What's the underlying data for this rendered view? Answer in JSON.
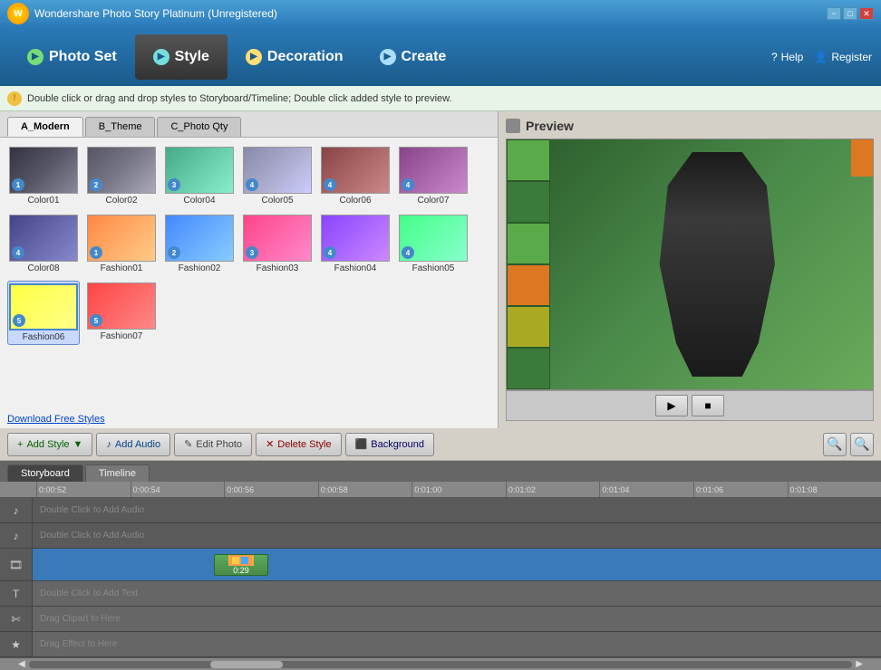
{
  "app": {
    "title": "Wondershare Photo Story Platinum  (Unregistered)"
  },
  "titlebar": {
    "minimize": "−",
    "maximize": "□",
    "close": "✕"
  },
  "navbar": {
    "items": [
      {
        "id": "photo-set",
        "label": "Photo Set",
        "icon": "▶"
      },
      {
        "id": "style",
        "label": "Style",
        "icon": "▶"
      },
      {
        "id": "decoration",
        "label": "Decoration",
        "icon": "▶"
      },
      {
        "id": "create",
        "label": "Create",
        "icon": "▶"
      }
    ],
    "help_label": "Help",
    "register_label": "Register"
  },
  "infobar": {
    "message": "Double click or drag and drop styles to Storyboard/Timeline; Double click added style to preview."
  },
  "tabs": [
    {
      "id": "a_modern",
      "label": "A_Modern"
    },
    {
      "id": "b_theme",
      "label": "B_Theme"
    },
    {
      "id": "c_photo_qty",
      "label": "C_Photo Qty"
    }
  ],
  "styles": [
    {
      "id": "color01",
      "label": "Color01",
      "thumb_class": "t-color01",
      "badge": "1"
    },
    {
      "id": "color02",
      "label": "Color02",
      "thumb_class": "t-color02",
      "badge": "2"
    },
    {
      "id": "color04",
      "label": "Color04",
      "thumb_class": "t-color04",
      "badge": "3"
    },
    {
      "id": "color05",
      "label": "Color05",
      "thumb_class": "t-color05",
      "badge": "4"
    },
    {
      "id": "color06",
      "label": "Color06",
      "thumb_class": "t-color06",
      "badge": "4"
    },
    {
      "id": "color07",
      "label": "Color07",
      "thumb_class": "t-color07",
      "badge": "4"
    },
    {
      "id": "color08",
      "label": "Color08",
      "thumb_class": "t-color08",
      "badge": "4"
    },
    {
      "id": "fashion01",
      "label": "Fashion01",
      "thumb_class": "t-fashion01",
      "badge": "1"
    },
    {
      "id": "fashion02",
      "label": "Fashion02",
      "thumb_class": "t-fashion02",
      "badge": "2"
    },
    {
      "id": "fashion03",
      "label": "Fashion03",
      "thumb_class": "t-fashion03",
      "badge": "3"
    },
    {
      "id": "fashion04",
      "label": "Fashion04",
      "thumb_class": "t-fashion04",
      "badge": "4"
    },
    {
      "id": "fashion05",
      "label": "Fashion05",
      "thumb_class": "t-fashion05",
      "badge": "4"
    },
    {
      "id": "fashion06",
      "label": "Fashion06",
      "thumb_class": "t-fashion06",
      "badge": "5",
      "selected": true
    },
    {
      "id": "fashion07",
      "label": "Fashion07",
      "thumb_class": "t-fashion07",
      "badge": "5"
    }
  ],
  "download_link": "Download Free Styles",
  "preview": {
    "title": "Preview"
  },
  "toolbar": {
    "add_style_label": "+ Add Style",
    "add_audio_label": "♪ Add Audio",
    "edit_photo_label": "✎ Edit Photo",
    "delete_style_label": "✕ Delete Style",
    "background_label": "⬛ Background",
    "zoom_out": "−",
    "zoom_in": "+"
  },
  "board_tabs": [
    {
      "id": "storyboard",
      "label": "Storyboard"
    },
    {
      "id": "timeline",
      "label": "Timeline"
    }
  ],
  "ruler": {
    "marks": [
      "0:00:52",
      "0:00:54",
      "0:00:56",
      "0:00:58",
      "0:01:00",
      "0:01:02",
      "0:01:04",
      "0:01:06",
      "0:01:08"
    ]
  },
  "tracks": [
    {
      "id": "audio1",
      "icon": "♪",
      "placeholder": "Double Click to Add Audio"
    },
    {
      "id": "audio2",
      "icon": "♪",
      "placeholder": "Double Click to Add Audio"
    },
    {
      "id": "video",
      "icon": "🎞",
      "clip_time": "0:29"
    },
    {
      "id": "text",
      "icon": "T",
      "placeholder": "Double Click to Add Text"
    },
    {
      "id": "clipart",
      "icon": "✄",
      "placeholder": "Drag Clipart to Here"
    },
    {
      "id": "effect",
      "icon": "★",
      "placeholder": "Drag Effect to Here"
    }
  ]
}
